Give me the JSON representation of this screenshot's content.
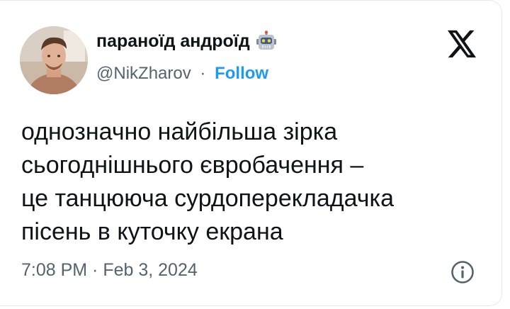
{
  "author": {
    "display_name": "параноїд андроїд",
    "badge_emoji_icon": "robot-face-icon",
    "handle": "@NikZharov",
    "separator": "·",
    "follow_label": "Follow"
  },
  "platform_icon": "x-logo-icon",
  "tweet": {
    "lines": [
      "однозначно найбільша зірка",
      "сьогоднішнього євробачення –",
      "це танцююча сурдоперекладачка",
      "пісень в куточку екрана"
    ]
  },
  "meta": {
    "timestamp": "7:08 PM · Feb 3, 2024",
    "info_icon": "info-icon"
  },
  "colors": {
    "accent": "#1d9bf0",
    "text_primary": "#0f1419",
    "text_secondary": "#536471"
  }
}
